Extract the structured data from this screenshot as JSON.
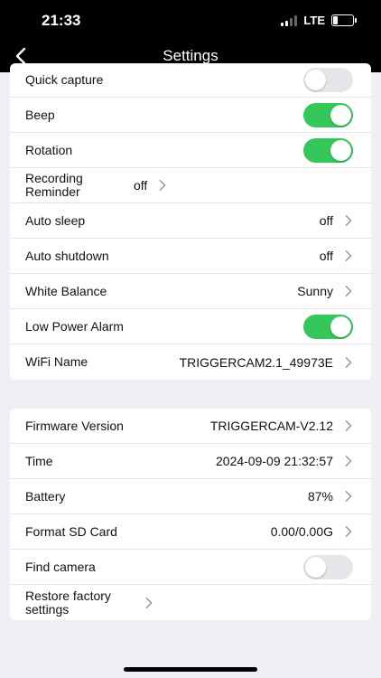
{
  "status_bar": {
    "time": "21:33",
    "network": "LTE",
    "battery_level": 0.25
  },
  "nav": {
    "title": "Settings"
  },
  "group1": [
    {
      "label": "Quick capture",
      "type": "toggle",
      "on": false
    },
    {
      "label": "Beep",
      "type": "toggle",
      "on": true
    },
    {
      "label": "Rotation",
      "type": "toggle",
      "on": true
    },
    {
      "label": "Recording Reminder",
      "type": "value",
      "value": "off"
    },
    {
      "label": "Auto sleep",
      "type": "value",
      "value": "off"
    },
    {
      "label": "Auto shutdown",
      "type": "value",
      "value": "off"
    },
    {
      "label": "White Balance",
      "type": "value",
      "value": "Sunny"
    },
    {
      "label": "Low Power Alarm",
      "type": "toggle",
      "on": true
    },
    {
      "label": "WiFi Name",
      "type": "value",
      "value": "TRIGGERCAM2.1_49973E"
    }
  ],
  "group2": [
    {
      "label": "Firmware Version",
      "type": "value",
      "value": "TRIGGERCAM-V2.12"
    },
    {
      "label": "Time",
      "type": "value",
      "value": "2024-09-09 21:32:57"
    },
    {
      "label": "Battery",
      "type": "value",
      "value": "87%"
    },
    {
      "label": "Format SD Card",
      "type": "value",
      "value": "0.00/0.00G"
    },
    {
      "label": "Find camera",
      "type": "toggle",
      "on": false
    },
    {
      "label": "Restore factory settings",
      "type": "value",
      "value": ""
    }
  ],
  "colors": {
    "toggle_on": "#34c759",
    "toggle_off": "#e5e5ea",
    "background": "#efeff4",
    "chevron": "#8e8e93"
  }
}
